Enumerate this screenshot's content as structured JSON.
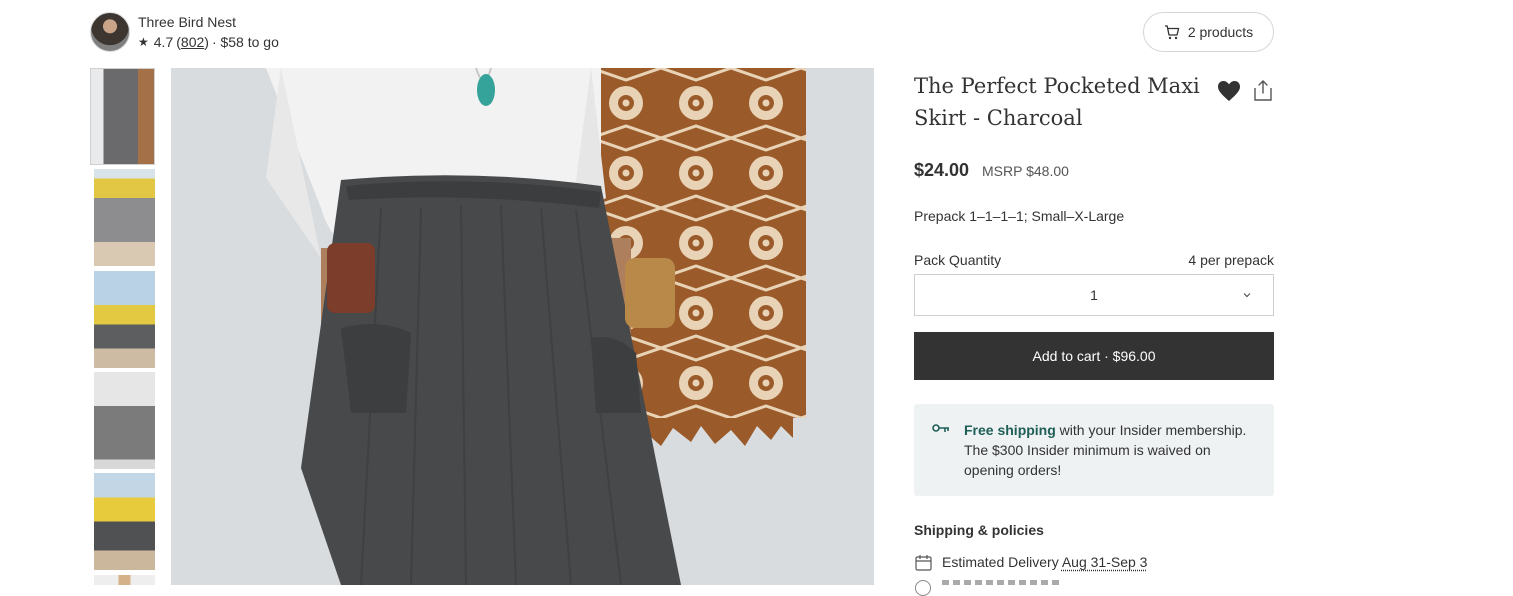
{
  "shop": {
    "name": "Three Bird Nest",
    "rating": "4.7",
    "reviews": "802",
    "to_go": "· $58 to go",
    "avatar_icon": "shop-avatar"
  },
  "cart": {
    "icon": "cart-icon",
    "label": "2 products"
  },
  "gallery": {
    "selected_index": 0,
    "thumbnail_count": 6
  },
  "product": {
    "title": "The Perfect Pocketed Maxi Skirt - Charcoal",
    "price": "$24.00",
    "msrp": "MSRP $48.00",
    "prepack": "Prepack 1–1–1–1; Small–X-Large",
    "pack_quantity_label": "Pack Quantity",
    "per_prepack": "4 per prepack",
    "quantity_value": "1",
    "add_to_cart": "Add to cart · $96.00"
  },
  "shipping_notice": {
    "highlight": "Free shipping",
    "text": " with your Insider membership. The $300 Insider minimum is waived on opening orders!",
    "icon": "key-icon"
  },
  "policies": {
    "heading": "Shipping & policies",
    "delivery_label": "Estimated Delivery",
    "delivery_dates": "Aug 31-Sep 3"
  },
  "colors": {
    "button_bg": "#333333",
    "notice_bg": "#eef2f3",
    "notice_highlight": "#1f5e56"
  }
}
